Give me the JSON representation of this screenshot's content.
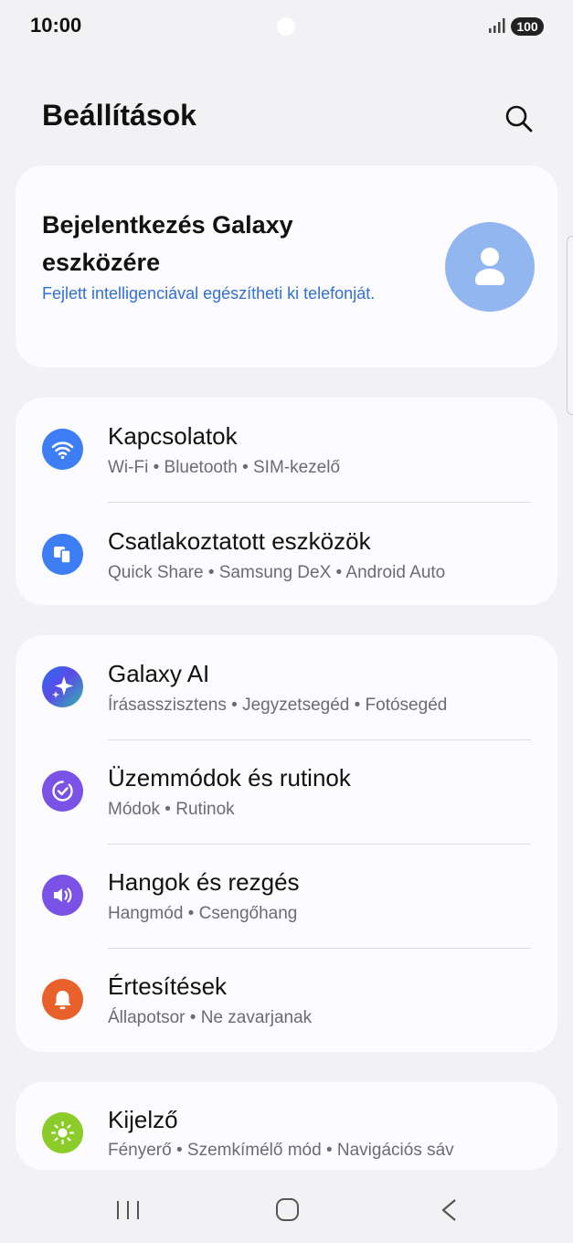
{
  "status": {
    "time": "10:00",
    "battery": "100"
  },
  "header": {
    "title": "Beállítások"
  },
  "account": {
    "title": "Bejelentkezés Galaxy eszközére",
    "subtitle": "Fejlett intelligenciával egészítheti ki telefonját."
  },
  "groups": [
    {
      "items": [
        {
          "title": "Kapcsolatok",
          "subtitle": "Wi-Fi • Bluetooth • SIM-kezelő",
          "icon": "wifi-icon",
          "color": "#3d7ef5"
        },
        {
          "title": "Csatlakoztatott eszközök",
          "subtitle": "Quick Share • Samsung DeX • Android Auto",
          "icon": "connected-devices-icon",
          "color": "#3d7ef5"
        }
      ]
    },
    {
      "items": [
        {
          "title": "Galaxy AI",
          "subtitle": "Írásasszisztens • Jegyzetsegéd • Fotósegéd",
          "icon": "galaxy-ai-icon",
          "color": "#4a6fe8"
        },
        {
          "title": "Üzemmódok és rutinok",
          "subtitle": "Módok • Rutinok",
          "icon": "modes-routines-icon",
          "color": "#7a52e6"
        },
        {
          "title": "Hangok és rezgés",
          "subtitle": "Hangmód • Csengőhang",
          "icon": "sound-icon",
          "color": "#7a52e6"
        },
        {
          "title": "Értesítések",
          "subtitle": "Állapotsor • Ne zavarjanak",
          "icon": "bell-icon",
          "color": "#e8612a"
        }
      ]
    },
    {
      "items": [
        {
          "title": "Kijelző",
          "subtitle": "Fényerő • Szemkímélő mód • Navigációs sáv",
          "icon": "display-brightness-icon",
          "color": "#8ccc2a"
        }
      ]
    }
  ],
  "nav": {
    "recents_icon": "recents-icon",
    "home_icon": "home-icon",
    "back_icon": "back-icon"
  }
}
